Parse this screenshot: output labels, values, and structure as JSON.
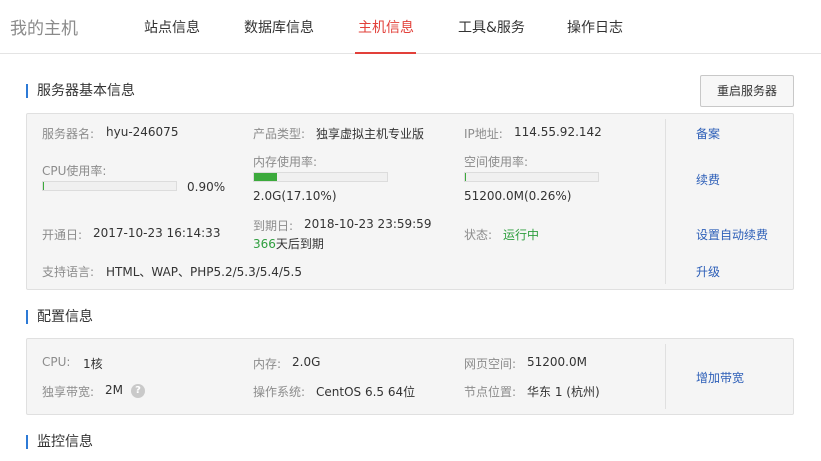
{
  "header": {
    "brand": "我的主机",
    "nav": [
      {
        "label": "站点信息"
      },
      {
        "label": "数据库信息"
      },
      {
        "label": "主机信息",
        "active": true
      },
      {
        "label": "工具&服务"
      },
      {
        "label": "操作日志"
      }
    ],
    "accent_color": "#e2403a"
  },
  "basic": {
    "title": "服务器基本信息",
    "restart_label": "重启服务器",
    "server_name_label": "服务器名:",
    "server_name": "hyu-246075",
    "product_type_label": "产品类型:",
    "product_type": "独享虚拟主机专业版",
    "ip_label": "IP地址:",
    "ip": "114.55.92.142",
    "cpu_label": "CPU使用率:",
    "cpu_value": "0.90%",
    "cpu_fraction": 0.009,
    "mem_label": "内存使用率:",
    "mem_value": "2.0G(17.10%)",
    "mem_fraction": 0.171,
    "space_label": "空间使用率:",
    "space_value": "51200.0M(0.26%)",
    "space_fraction": 0.0026,
    "open_label": "开通日:",
    "open_date": "2017-10-23 16:14:33",
    "expire_label": "到期日:",
    "expire_date": "2018-10-23 23:59:59",
    "days_left": "366",
    "days_suffix": "天后到期",
    "status_label": "状态:",
    "status": "运行中",
    "lang_label": "支持语言:",
    "languages": "HTML、WAP、PHP5.2/5.3/5.4/5.5",
    "links": {
      "record": "备案",
      "renew": "续费",
      "auto_renew": "设置自动续费",
      "upgrade": "升级"
    }
  },
  "config": {
    "title": "配置信息",
    "cpu_label": "CPU:",
    "cpu": "1核",
    "mem_label": "内存:",
    "mem": "2.0G",
    "web_space_label": "网页空间:",
    "web_space": "51200.0M",
    "bandwidth_label": "独享带宽:",
    "bandwidth": "2M",
    "os_label": "操作系统:",
    "os": "CentOS 6.5 64位",
    "node_label": "节点位置:",
    "node": "华东 1 (杭州)",
    "add_bandwidth": "增加带宽"
  },
  "monitor": {
    "title": "监控信息"
  }
}
